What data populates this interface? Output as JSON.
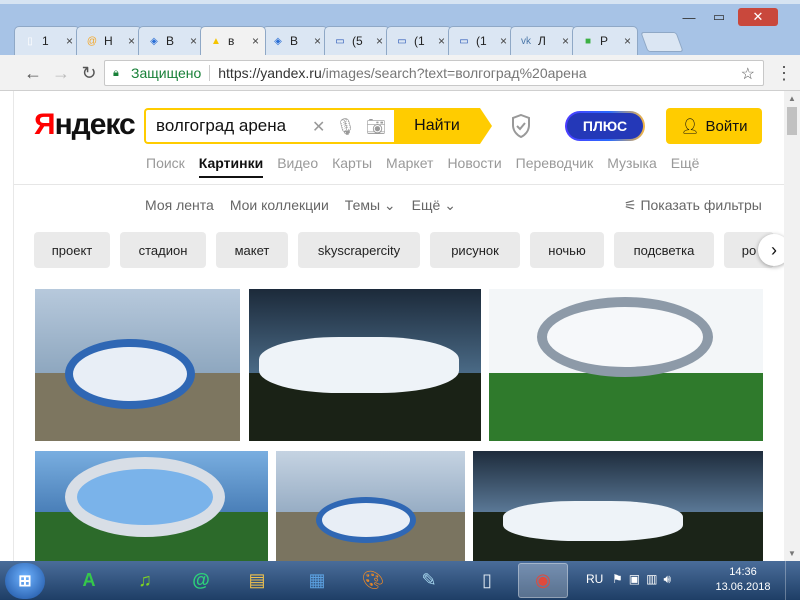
{
  "browser": {
    "tabs": [
      {
        "title": "1",
        "favicon": "document-icon",
        "color": "#ffffff",
        "glyph": "▯"
      },
      {
        "title": "H",
        "favicon": "mail-at-icon",
        "color": "#f5a623",
        "glyph": "@"
      },
      {
        "title": "B",
        "favicon": "vk-cube-icon",
        "color": "#2b6fd6",
        "glyph": "◈"
      },
      {
        "title": "в",
        "favicon": "images-icon",
        "color": "#f5c400",
        "glyph": "▲"
      },
      {
        "title": "B",
        "favicon": "vk-cube-icon",
        "color": "#2b6fd6",
        "glyph": "◈"
      },
      {
        "title": "(5",
        "favicon": "window-icon",
        "color": "#1f4fb4",
        "glyph": "▭"
      },
      {
        "title": "(1",
        "favicon": "window-icon",
        "color": "#1f4fb4",
        "glyph": "▭"
      },
      {
        "title": "(1",
        "favicon": "window-icon",
        "color": "#1f4fb4",
        "glyph": "▭"
      },
      {
        "title": "Л",
        "favicon": "vk-icon",
        "color": "#4a76a8",
        "glyph": "vk"
      },
      {
        "title": "P",
        "favicon": "green-square-icon",
        "color": "#3cb043",
        "glyph": "■"
      }
    ],
    "active_tab_index": 3,
    "secure_label": "Защищено",
    "url_domain": "https://yandex.ru",
    "url_rest": "/images/search?text=волгоград%20арена",
    "window_buttons": {
      "minimize": "—",
      "maximize": "▭",
      "close": "✕"
    }
  },
  "yandex": {
    "logo_first": "Я",
    "logo_rest": "ндекс",
    "search_query": "волгоград арена",
    "find_label": "Найти",
    "plus_label": "ПЛЮС",
    "login_label": "Войти",
    "services": [
      "Поиск",
      "Картинки",
      "Видео",
      "Карты",
      "Маркет",
      "Новости",
      "Переводчик",
      "Музыка",
      "Ещё"
    ],
    "active_service_index": 1,
    "subnav": [
      "Моя лента",
      "Мои коллекции",
      "Темы",
      "Ещё"
    ],
    "show_filters_label": "Показать фильтры",
    "tags": [
      {
        "label": "проект",
        "width": 76
      },
      {
        "label": "стадион",
        "width": 86
      },
      {
        "label": "макет",
        "width": 72
      },
      {
        "label": "skyscrapercity",
        "width": 122
      },
      {
        "label": "рисунок",
        "width": 90
      },
      {
        "label": "ночью",
        "width": 74
      },
      {
        "label": "подсветка",
        "width": 100
      },
      {
        "label": "ро",
        "width": 50
      }
    ]
  },
  "taskbar": {
    "lang": "RU",
    "time": "14:36",
    "date": "13.06.2018"
  }
}
